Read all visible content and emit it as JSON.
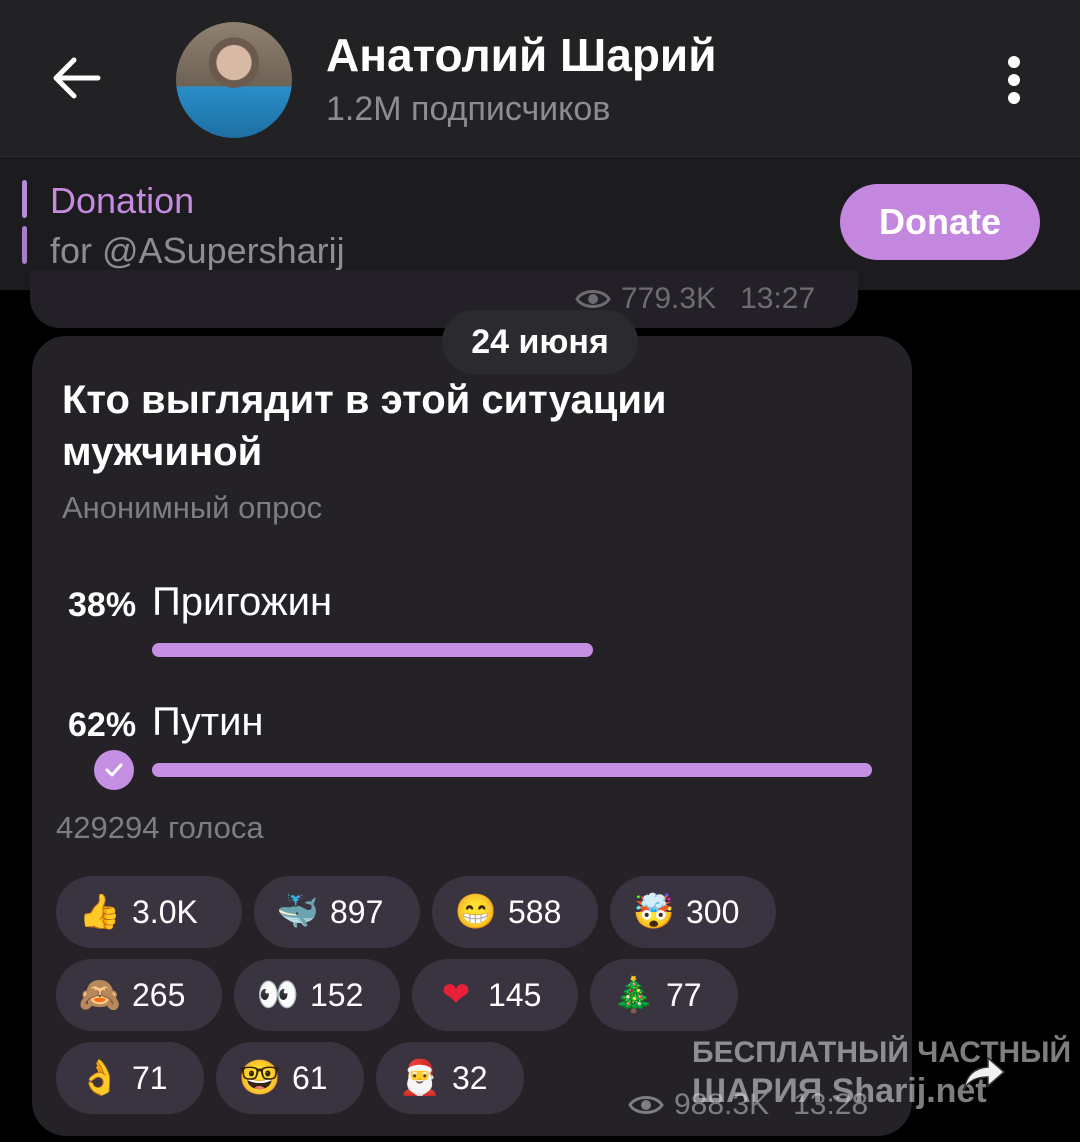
{
  "header": {
    "title": "Анатолий Шарий",
    "subtitle": "1.2M подписчиков"
  },
  "pinned": {
    "title": "Donation",
    "subtitle": "for @ASupersharij",
    "button_label": "Donate"
  },
  "previous_message": {
    "views": "779.3K",
    "time": "13:27"
  },
  "date_chip": "24 июня",
  "poll": {
    "question": "Кто выглядит в этой ситуации мужчиной",
    "type_label": "Анонимный опрос",
    "options": [
      {
        "percent_label": "38%",
        "label": "Пригожин",
        "fraction": 0.38
      },
      {
        "percent_label": "62%",
        "label": "Путин",
        "fraction": 0.62
      }
    ],
    "votes_label": "429294 голоса"
  },
  "reactions": [
    {
      "emoji": "👍",
      "count": "3.0K"
    },
    {
      "emoji": "🐳",
      "count": "897"
    },
    {
      "emoji": "😁",
      "count": "588"
    },
    {
      "emoji": "🤯",
      "count": "300"
    },
    {
      "emoji": "🙈",
      "count": "265"
    },
    {
      "emoji": "👀",
      "count": "152"
    },
    {
      "emoji": "❤",
      "count": "145"
    },
    {
      "emoji": "🎄",
      "count": "77"
    },
    {
      "emoji": "👌",
      "count": "71"
    },
    {
      "emoji": "🤓",
      "count": "61"
    },
    {
      "emoji": "🎅",
      "count": "32"
    }
  ],
  "message_meta": {
    "views": "988.3K",
    "time": "13:28"
  },
  "watermark": {
    "line1": "БЕСПЛАТНЫЙ ЧАСТНЫЙ",
    "line2": "ШАРИЯ Sharij.net"
  },
  "colors": {
    "accent": "#c58fe3",
    "header_bg": "#222124",
    "bubble_bg": "#242227"
  }
}
